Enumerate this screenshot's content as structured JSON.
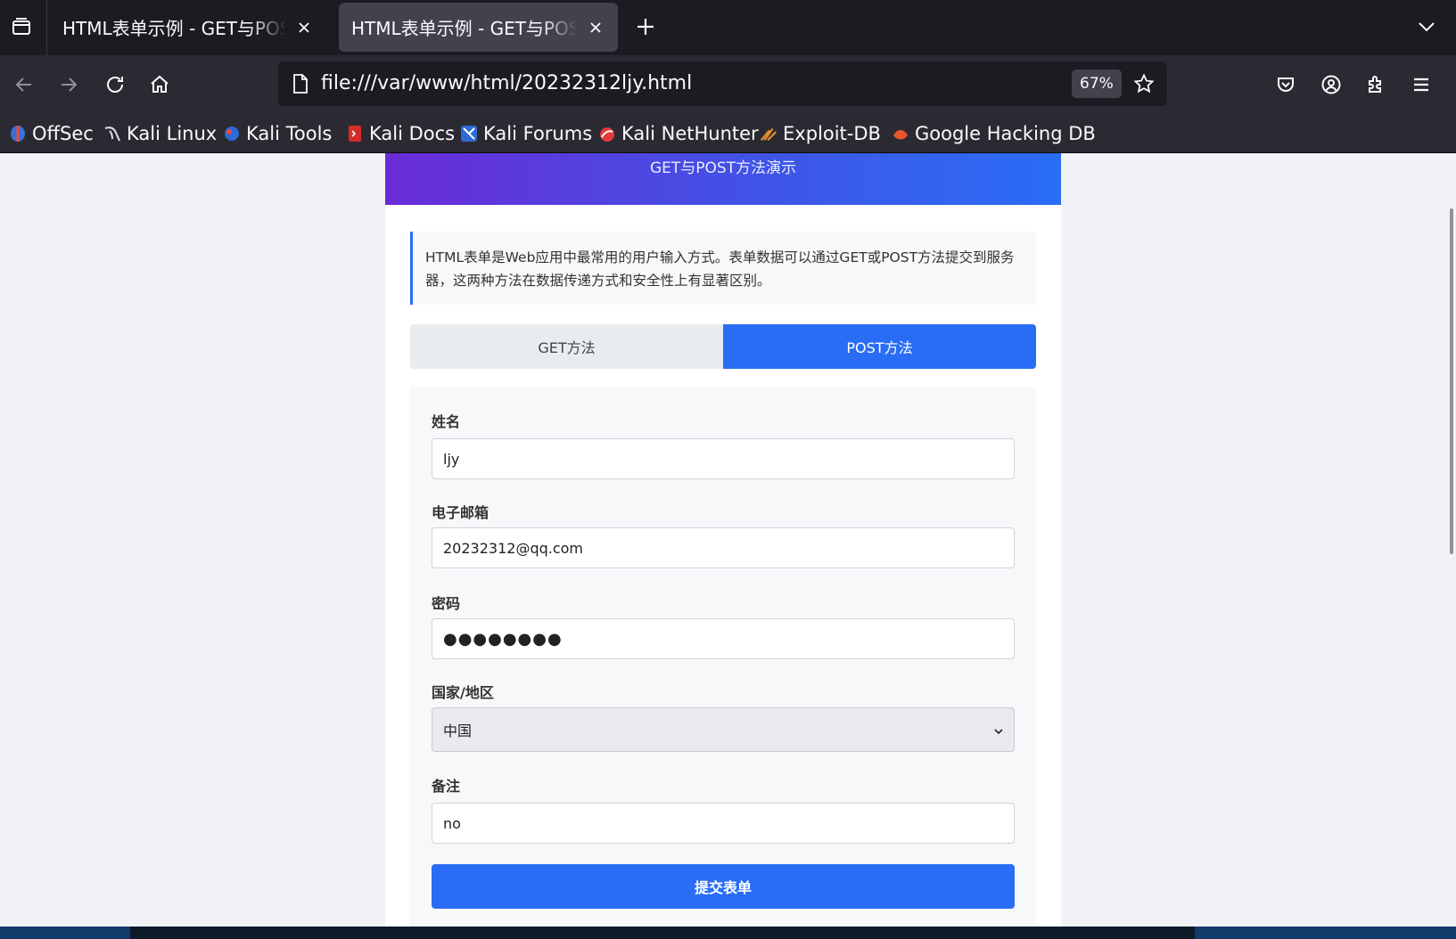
{
  "browser": {
    "tabs": [
      {
        "title": "HTML表单示例 - GET与POST方法演示",
        "active": false
      },
      {
        "title": "HTML表单示例 - GET与POST方法演示",
        "active": true
      }
    ],
    "url": "file:///var/www/html/20232312ljy.html",
    "zoom": "67%",
    "bookmarks": [
      {
        "label": "OffSec",
        "icon": "offsec-icon"
      },
      {
        "label": "Kali Linux",
        "icon": "kali-dragon-icon"
      },
      {
        "label": "Kali Tools",
        "icon": "kali-tools-icon"
      },
      {
        "label": "Kali Docs",
        "icon": "kali-docs-icon"
      },
      {
        "label": "Kali Forums",
        "icon": "kali-forums-icon"
      },
      {
        "label": "Kali NetHunter",
        "icon": "nethunter-icon"
      },
      {
        "label": "Exploit-DB",
        "icon": "exploit-db-icon"
      },
      {
        "label": "Google Hacking DB",
        "icon": "ghdb-icon"
      }
    ]
  },
  "page": {
    "subtitle": "GET与POST方法演示",
    "info": "HTML表单是Web应用中最常用的用户输入方式。表单数据可以通过GET或POST方法提交到服务器，这两种方法在数据传递方式和安全性上有显著区别。",
    "tabs": {
      "get": "GET方法",
      "post": "POST方法",
      "active": "post"
    },
    "form": {
      "name_label": "姓名",
      "name_value": "ljy",
      "email_label": "电子邮箱",
      "email_value": "20232312@qq.com",
      "password_label": "密码",
      "password_value": "●●●●●●●●",
      "country_label": "国家/地区",
      "country_value": "中国",
      "notes_label": "备注",
      "notes_value": "no",
      "submit_label": "提交表单"
    }
  },
  "colors": {
    "accent": "#2a6df5",
    "header_gradient_start": "#6a2bd6",
    "chrome_dark": "#1c1b22",
    "chrome_toolbar": "#2b2a33"
  }
}
